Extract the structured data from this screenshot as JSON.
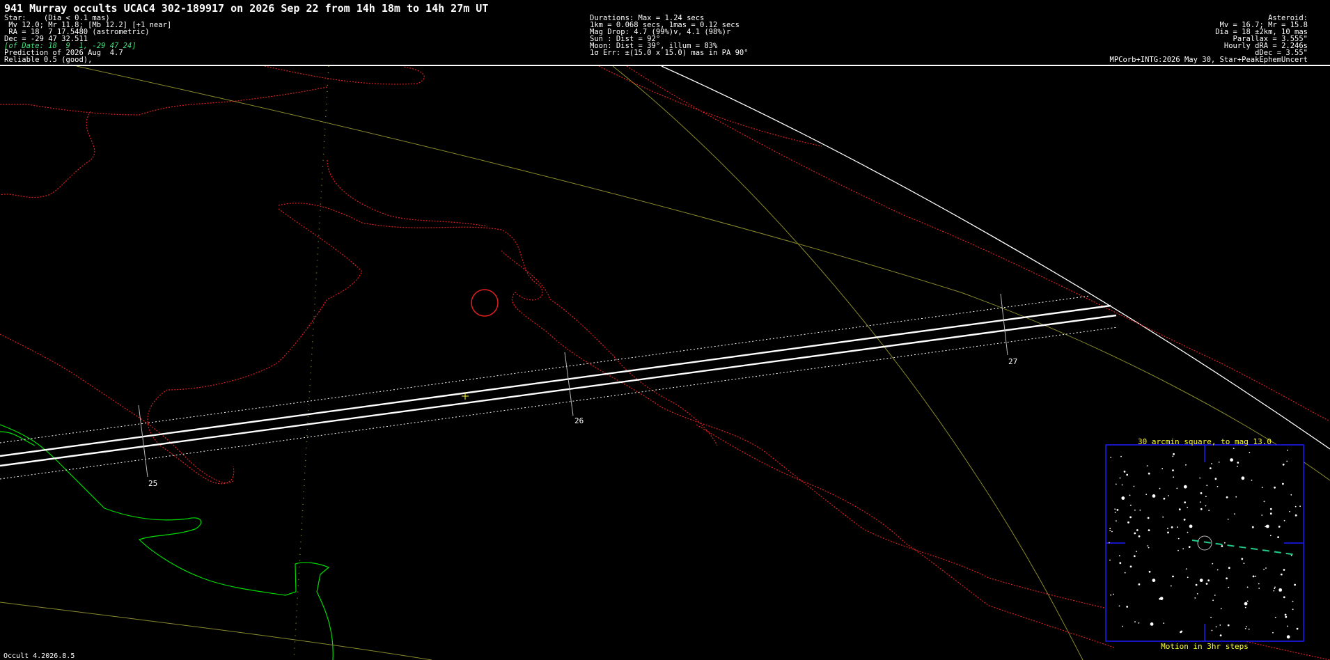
{
  "title": "941 Murray occults UCAC4 302-189917 on 2026 Sep 22 from 14h 18m to 14h 27m UT",
  "star_block": [
    "Star:    (Dia < 0.1 mas)",
    " Mv 12.0; Mr 11.8; [Mb 12.2] [+1 near]",
    " RA = 18  7 17.5480 (astrometric)",
    "Dec = -29 47 32.511",
    "[of Date: 18  9  1, -29 47 24]",
    "Prediction of 2026 Aug  4.7",
    "Reliable 0.5 (good),"
  ],
  "circumstances_block": [
    "Durations: Max = 1.24 secs",
    "1km = 0.068 secs, 1mas = 0.12 secs",
    "Mag Drop: 4.7 (99%)v, 4.1 (98%)r",
    "Sun : Dist = 92°",
    "Moon: Dist = 39°, illum = 83%",
    "1σ Err: ±(15.0 x 15.0) mas in PA 90°"
  ],
  "asteroid_block": [
    "Asteroid:",
    "Mv = 16.7; Mr = 15.8",
    "Dia = 18 ±2km, 10 mas",
    "Parallax = 3.555\"",
    "Hourly dRA = 2.246s",
    "dDec = 3.55\"",
    "MPCorb+INTG:2026 May 30, Star+PeakEphemUncert"
  ],
  "time_marks": [
    "25",
    "26",
    "27"
  ],
  "inset": {
    "title": "30 arcmin square, to mag 13.0",
    "caption": "Motion in 3hr steps"
  },
  "footer": "Occult 4.2026.8.5",
  "colors": {
    "background": "#000000",
    "path": "#ffffff",
    "coastline": "#00dd00",
    "border": "#e02020",
    "graticule": "#8a8a2a",
    "inset_frame": "#1a1aff",
    "inset_text": "#ffff33",
    "motion": "#22cc88"
  }
}
